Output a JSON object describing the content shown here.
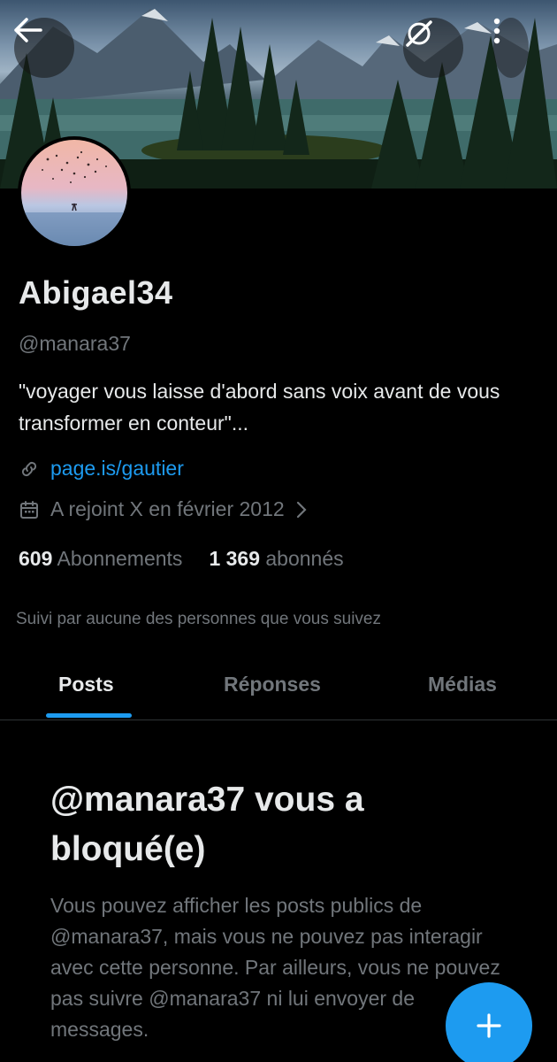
{
  "profile": {
    "display_name": "Abigael34",
    "handle": "@manara37",
    "bio": "\"voyager vous laisse d'abord sans voix avant de vous transformer en conteur\"...",
    "link": "page.is/gautier",
    "joined": "A rejoint X en février 2012",
    "following_count": "609",
    "following_label": "Abonnements",
    "followers_count": "1 369",
    "followers_label": "abonnés",
    "followed_by_text": "Suivi par aucune des personnes que vous suivez"
  },
  "tabs": [
    {
      "label": "Posts",
      "active": true
    },
    {
      "label": "Réponses",
      "active": false
    },
    {
      "label": "Médias",
      "active": false
    }
  ],
  "blocked": {
    "title": "@manara37 vous a bloqué(e)",
    "body": "Vous pouvez afficher les posts publics de @manara37, mais vous ne pouvez pas interagir avec cette personne. Par ailleurs, vous ne pouvez pas suivre @manara37 ni lui envoyer de messages."
  },
  "icons": {
    "back": "back-arrow-icon",
    "grok": "grok-icon",
    "more": "more-vertical-icon",
    "link": "link-icon",
    "calendar": "calendar-icon",
    "chevron": "chevron-right-icon",
    "compose": "plus-icon"
  },
  "colors": {
    "accent": "#1d9bf0",
    "background": "#000000",
    "primary_text": "#e7e9ea",
    "secondary_text": "#71767b"
  }
}
